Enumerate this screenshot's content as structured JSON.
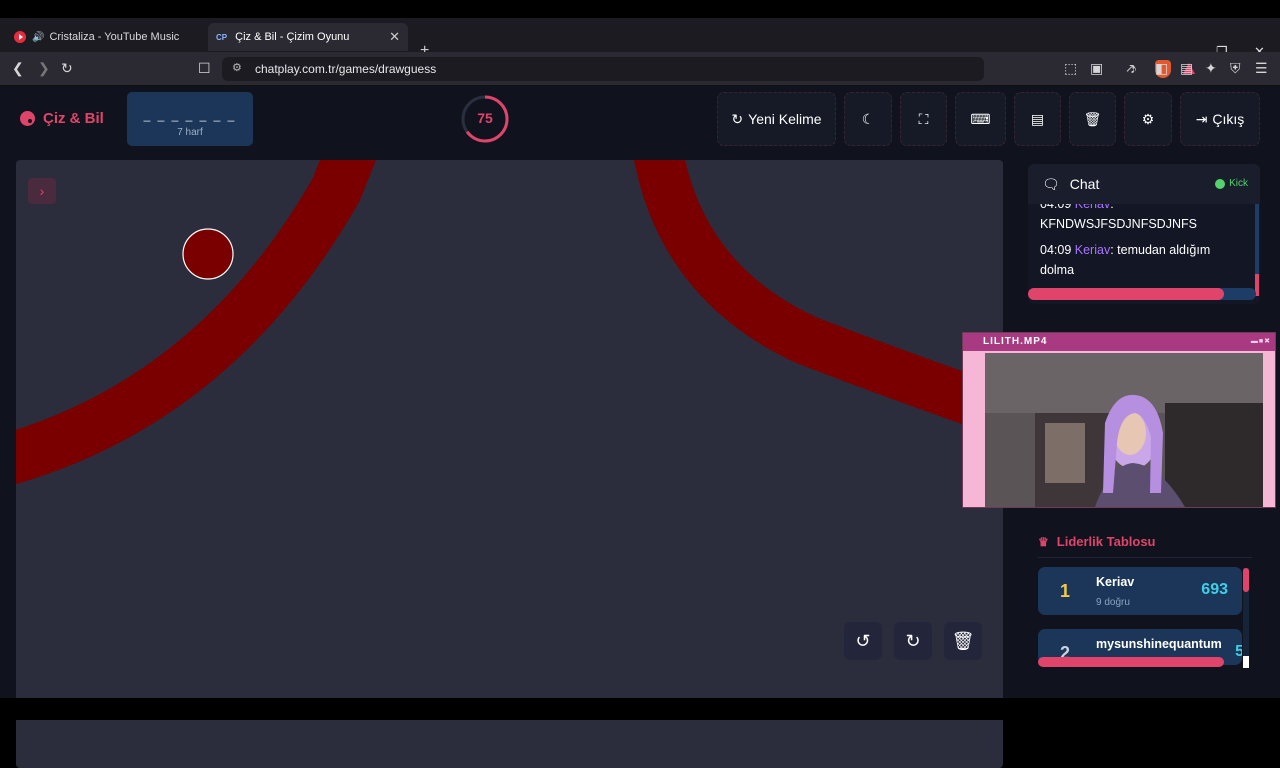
{
  "browser": {
    "tabs": [
      {
        "title": "Cristaliza - YouTube Music"
      },
      {
        "title": "Çiz & Bil - Çizim Oyunu",
        "favicon_text": "CP"
      }
    ],
    "url": "chatplay.com.tr/games/drawguess"
  },
  "header": {
    "brand": "Çiz & Bil",
    "word_mask": "_ _ _ _ _ _ _",
    "word_length_label": "7 harf",
    "timer_value": "75",
    "timer_progress": 0.65,
    "buttons": {
      "new_word": "Yeni Kelime",
      "exit": "Çıkış"
    }
  },
  "chat": {
    "title": "Chat",
    "status": "Kick",
    "messages": [
      {
        "time": "04:09",
        "user": "Keriav",
        "text": "KFNDWSJFSDJNFSDJNFS"
      },
      {
        "time": "04:09",
        "user": "Keriav",
        "text": "temudan aldığım dolma"
      }
    ],
    "scroll_fraction": 0.86
  },
  "video": {
    "title": "LILITH.MP4"
  },
  "leaderboard": {
    "title": "Liderlik Tablosu",
    "entries": [
      {
        "rank": "1",
        "name": "Keriav",
        "detail": "9 doğru",
        "score": "693"
      },
      {
        "rank": "2",
        "name": "mysunshinequantum",
        "detail": "",
        "score": "5"
      }
    ]
  },
  "colors": {
    "accent": "#e0446a",
    "stroke": "#7a0000",
    "canvas_bg": "#2b2d3d",
    "panel": "#1b3658"
  }
}
